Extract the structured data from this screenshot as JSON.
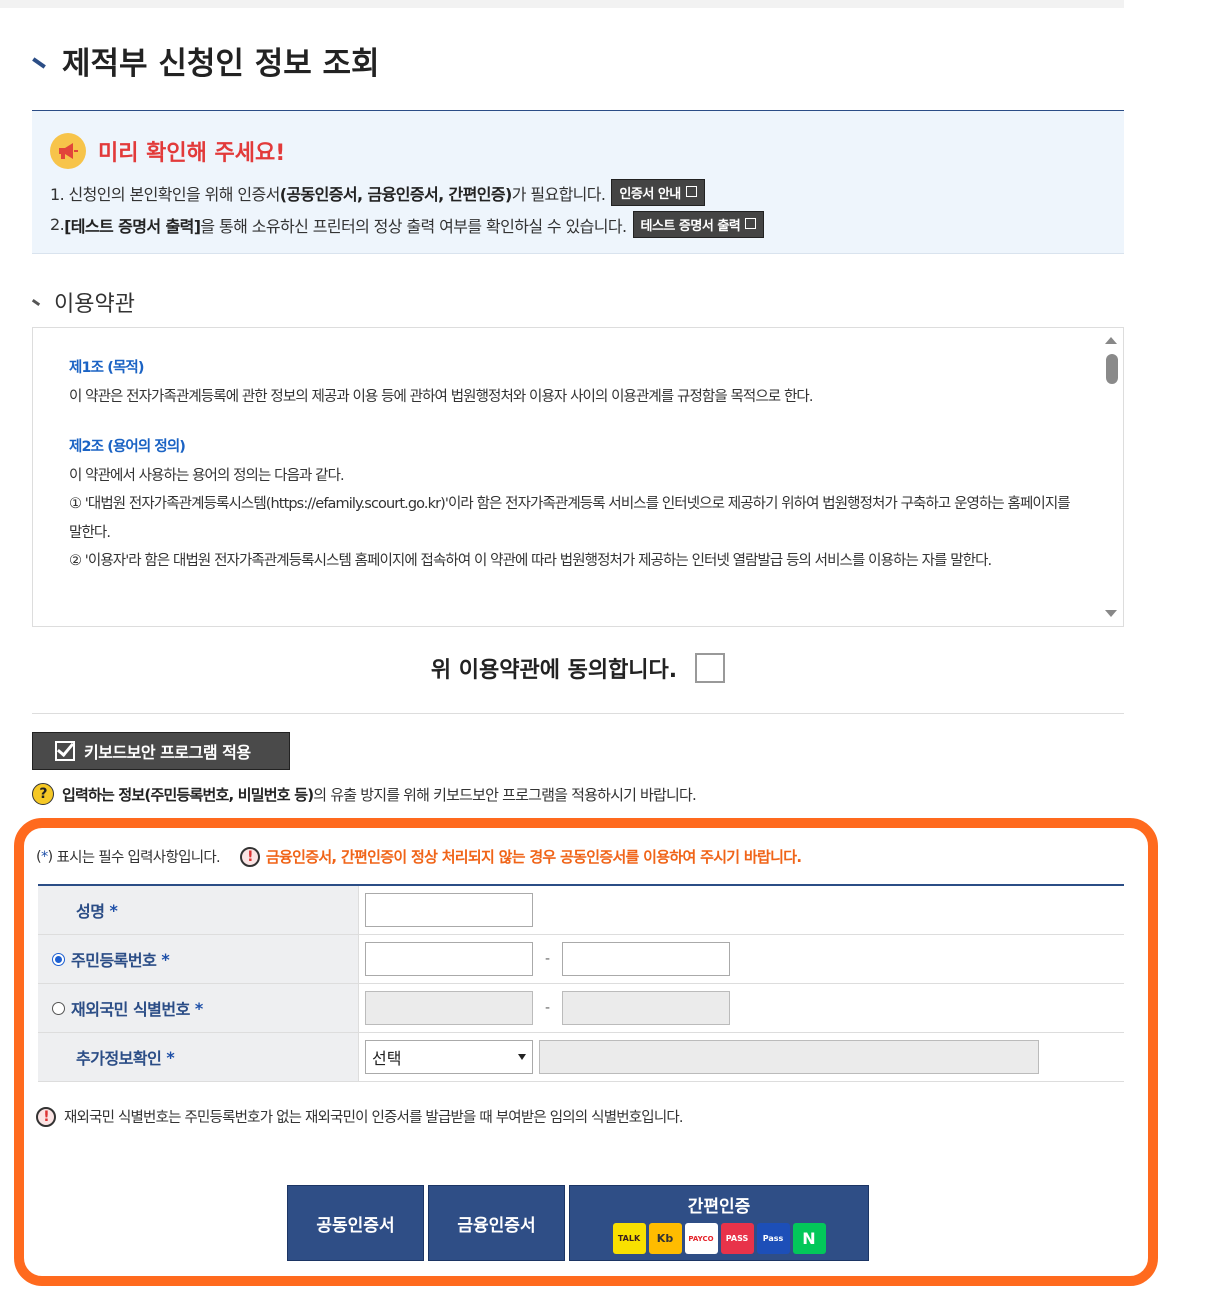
{
  "page": {
    "title": "제적부 신청인 정보 조회"
  },
  "notice": {
    "title": "미리 확인해 주세요!",
    "line1_pre": "1. 신청인의 본인확인을 위해 인증서",
    "line1_bold": "(공동인증서, 금융인증서, 간편인증)",
    "line1_post": "가 필요합니다.",
    "cert_guide_button": "인증서 안내",
    "line2_pre": "2. ",
    "line2_bold": "[테스트 증명서 출력]",
    "line2_post": "을 통해 소유하신 프린터의 정상 출력 여부를 확인하실 수 있습니다.",
    "test_print_button": "테스트 증명서 출력"
  },
  "terms": {
    "section_title": "이용약관",
    "articles": [
      {
        "title": "제1조 (목적)",
        "lines": [
          "이 약관은 전자가족관계등록에 관한 정보의 제공과 이용 등에 관하여 법원행정처와 이용자 사이의 이용관계를 규정함을 목적으로 한다."
        ]
      },
      {
        "title": "제2조 (용어의 정의)",
        "lines": [
          "이 약관에서 사용하는 용어의 정의는 다음과 같다.",
          "① '대법원 전자가족관계등록시스템(https://efamily.scourt.go.kr)'이라 함은 전자가족관계등록 서비스를 인터넷으로 제공하기 위하여 법원행정처가 구축하고 운영하는 홈페이지를 말한다.",
          "② '이용자'라 함은 대법원 전자가족관계등록시스템 홈페이지에 접속하여 이 약관에 따라 법원행정처가 제공하는 인터넷 열람발급 등의 서비스를 이용하는 자를 말한다."
        ]
      }
    ],
    "agree_label": "위 이용약관에 동의합니다."
  },
  "keyboard": {
    "button": "키보드보안 프로그램 적용",
    "note_bold": "입력하는 정보(주민등록번호, 비밀번호 등)",
    "note_rest": "의 유출 방지를 위해 키보드보안 프로그램을 적용하시기 바랍니다."
  },
  "form": {
    "required_note": "표시는 필수 입력사항입니다.",
    "required_prefix": "(",
    "required_star": "*",
    "required_suffix": ")",
    "warning": "금융인증서, 간편인증이 정상 처리되지 않는 경우 공동인증서를 이용하여 주시기 바랍니다.",
    "rows": {
      "name": "성명",
      "resident": "주민등록번호",
      "foreign": "재외국민 식별번호",
      "extra": "추가정보확인"
    },
    "star": "*",
    "dash": "-",
    "select_value": "선택",
    "resident_selected": true,
    "foreign_note": "재외국민 식별번호는 주민등록번호가 없는 재외국민이 인증서를 발급받을 때 부여받은 임의의 식별번호입니다."
  },
  "buttons": {
    "joint_cert": "공동인증서",
    "finance_cert": "금융인증서",
    "simple_auth": "간편인증",
    "providers": [
      "TALK",
      "Kb",
      "PAYCO",
      "PASS",
      "Pass",
      "N"
    ]
  },
  "colors": {
    "frame": "#ff6a1e",
    "navy": "#2f4e86",
    "warn": "#f06418",
    "notice_title": "#e23a3a"
  }
}
